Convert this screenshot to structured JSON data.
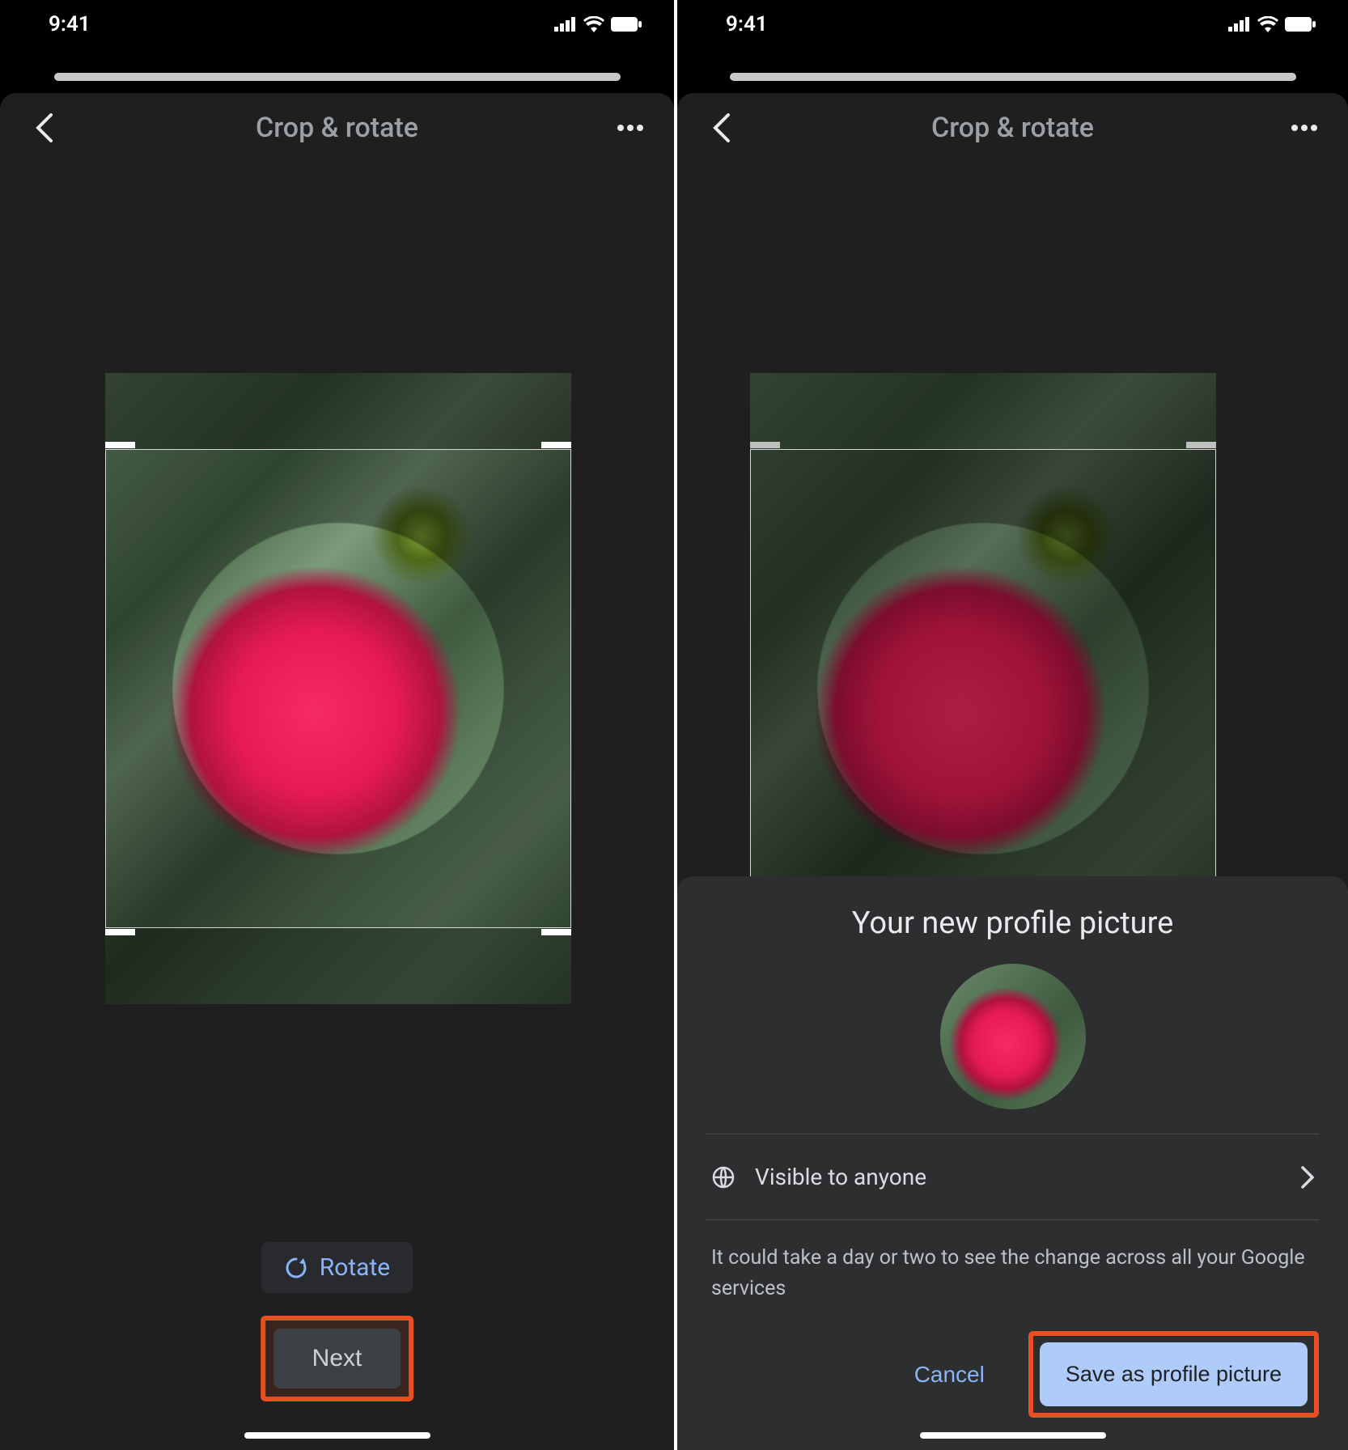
{
  "status_bar": {
    "time": "9:41"
  },
  "left": {
    "title": "Crop & rotate",
    "rotate_label": "Rotate",
    "next_label": "Next"
  },
  "right": {
    "title": "Crop & rotate",
    "sheet": {
      "title": "Your new profile picture",
      "visibility_label": "Visible to anyone",
      "disclaimer": "It could take a day or two to see the change across all your Google services",
      "cancel_label": "Cancel",
      "save_label": "Save as profile picture"
    }
  },
  "colors": {
    "highlight": "#e94f1f",
    "accent": "#8ab4f8",
    "save_button_bg": "#aecbfa"
  }
}
